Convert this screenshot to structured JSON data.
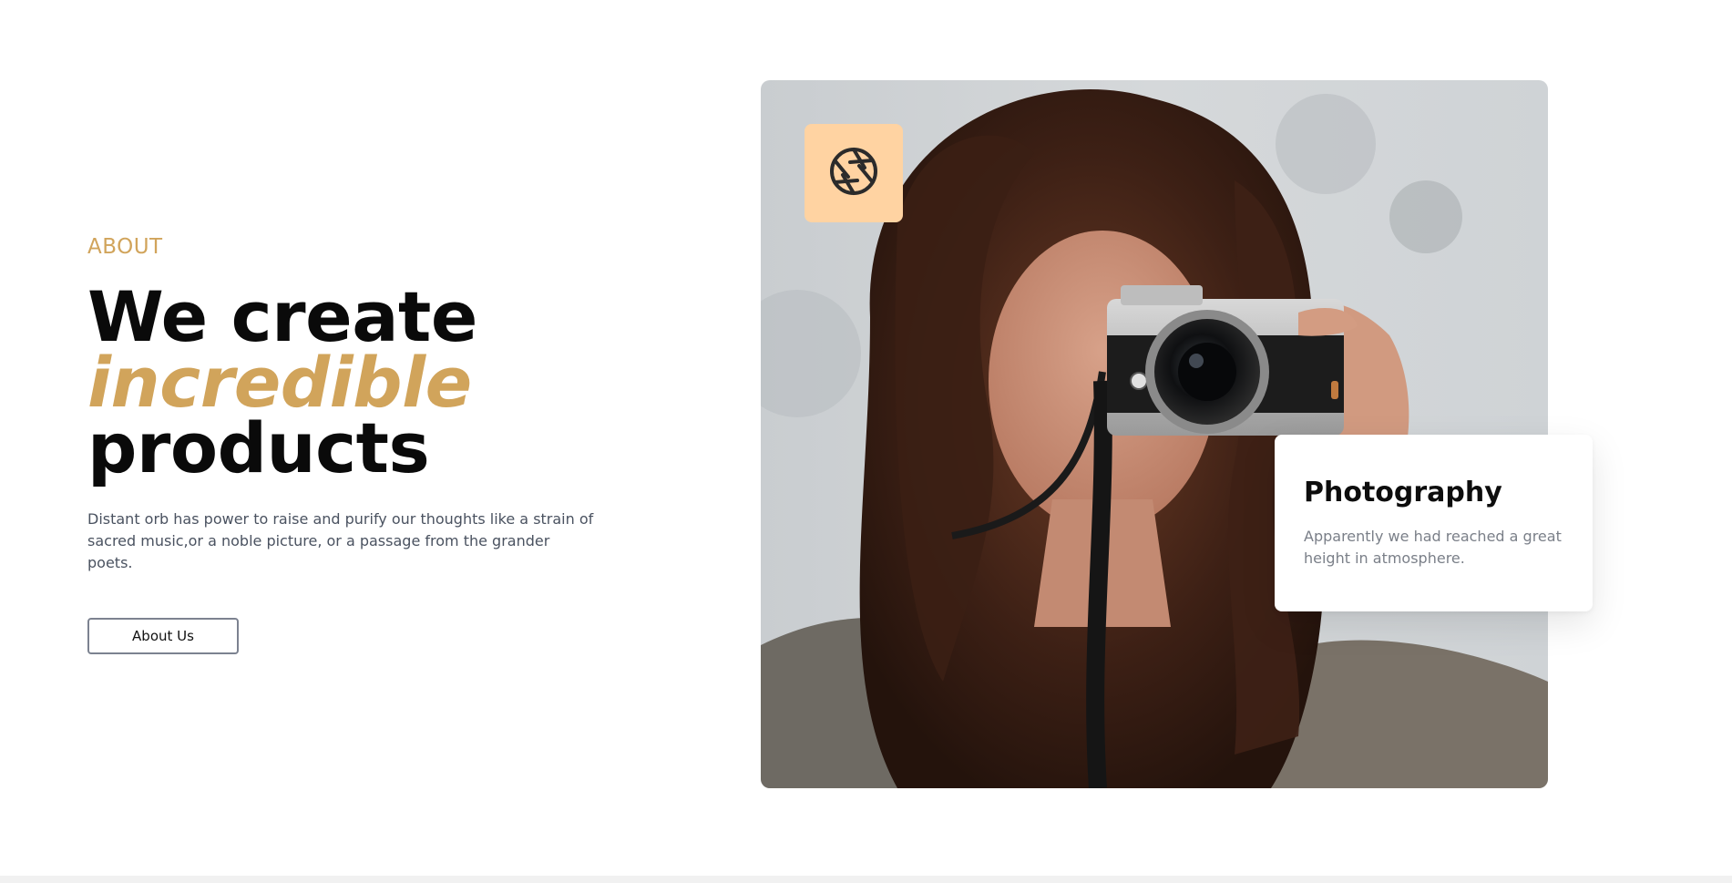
{
  "about": {
    "eyebrow": "ABOUT",
    "headline_line1": "We create",
    "headline_accent": "incredible",
    "headline_line3": "products",
    "description": "Distant orb has power to raise and purify our thoughts like a strain of sacred music,or a noble picture, or a passage from the grander poets.",
    "button_label": "About Us"
  },
  "feature_card": {
    "title": "Photography",
    "text": "Apparently we had reached a great height in atmosphere."
  },
  "icons": {
    "badge_icon": "camera-aperture-icon"
  },
  "colors": {
    "accent": "#d1a45b",
    "badge_background": "#ffd3a2",
    "text_muted": "#4a5260"
  }
}
